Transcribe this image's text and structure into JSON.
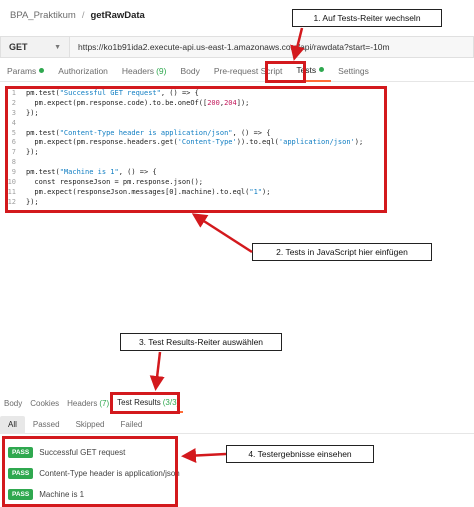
{
  "breadcrumb": {
    "collection": "BPA_Praktikum",
    "separator": "/",
    "request": "getRawData"
  },
  "request": {
    "method": "GET",
    "url": "https://ko1b91ida2.execute-api.us-east-1.amazonaws.com/api/rawdata?start=-10m"
  },
  "request_tabs": [
    {
      "label": "Params",
      "indicator": "dot"
    },
    {
      "label": "Authorization"
    },
    {
      "label": "Headers",
      "count": "(9)"
    },
    {
      "label": "Body"
    },
    {
      "label": "Pre-request Script"
    },
    {
      "label": "Tests",
      "indicator": "dot",
      "active": true
    },
    {
      "label": "Settings"
    }
  ],
  "editor": {
    "lines": [
      {
        "n": "1",
        "parts": [
          [
            "pm.test(",
            ""
          ],
          [
            "\"Successful GET request\"",
            "str"
          ],
          [
            ", () => {",
            ""
          ]
        ]
      },
      {
        "n": "2",
        "parts": [
          [
            "  pm.expect(pm.response.code).to.be.oneOf([",
            ""
          ],
          [
            "200",
            "num"
          ],
          [
            ",",
            ""
          ],
          [
            "204",
            "num"
          ],
          [
            "]);",
            ""
          ]
        ]
      },
      {
        "n": "3",
        "parts": [
          [
            "});",
            ""
          ]
        ]
      },
      {
        "n": "4",
        "parts": [
          [
            "",
            ""
          ]
        ]
      },
      {
        "n": "5",
        "parts": [
          [
            "pm.test(",
            ""
          ],
          [
            "\"Content-Type header is application/json\"",
            "str"
          ],
          [
            ", () => {",
            ""
          ]
        ]
      },
      {
        "n": "6",
        "parts": [
          [
            "  pm.expect(pm.response.headers.get(",
            ""
          ],
          [
            "'Content-Type'",
            "str"
          ],
          [
            ")).to.eql(",
            ""
          ],
          [
            "'application/json'",
            "str"
          ],
          [
            ");",
            ""
          ]
        ]
      },
      {
        "n": "7",
        "parts": [
          [
            "});",
            ""
          ]
        ]
      },
      {
        "n": "8",
        "parts": [
          [
            "",
            ""
          ]
        ]
      },
      {
        "n": "9",
        "parts": [
          [
            "pm.test(",
            ""
          ],
          [
            "\"Machine is 1\"",
            "str"
          ],
          [
            ", () => {",
            ""
          ]
        ]
      },
      {
        "n": "10",
        "parts": [
          [
            "  const responseJson = pm.response.json();",
            ""
          ]
        ]
      },
      {
        "n": "11",
        "parts": [
          [
            "  pm.expect(responseJson.messages[0].machine).to.eql(",
            ""
          ],
          [
            "\"1\"",
            "str"
          ],
          [
            ");",
            ""
          ]
        ]
      },
      {
        "n": "12",
        "parts": [
          [
            "});",
            ""
          ]
        ]
      }
    ]
  },
  "response_tabs": [
    {
      "label": "Body"
    },
    {
      "label": "Cookies"
    },
    {
      "label": "Headers",
      "count": "(7)"
    },
    {
      "label": "Test Results",
      "count": "(3/3)",
      "active": true
    }
  ],
  "filters": [
    {
      "label": "All",
      "active": true
    },
    {
      "label": "Passed"
    },
    {
      "label": "Skipped"
    },
    {
      "label": "Failed"
    }
  ],
  "results": [
    {
      "status": "PASS",
      "name": "Successful GET request"
    },
    {
      "status": "PASS",
      "name": "Content-Type header is application/json"
    },
    {
      "status": "PASS",
      "name": "Machine is 1"
    }
  ],
  "callouts": {
    "step1": "1. Auf Tests-Reiter wechseln",
    "step2": "2. Tests in JavaScript hier einfügen",
    "step3": "3. Test Results-Reiter auswählen",
    "step4": "4. Testergebnisse einsehen"
  },
  "colors": {
    "annotation": "#d3191d",
    "pass": "#2fa84f",
    "accent": "#ff6c37"
  }
}
